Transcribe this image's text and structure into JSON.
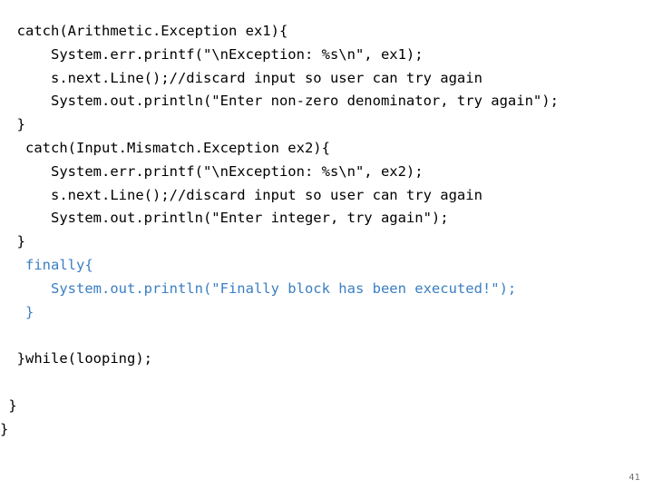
{
  "slide": {
    "page_number": "41",
    "code_lines": [
      {
        "indent": "  ",
        "segments": [
          {
            "text": "catch(Arithmetic.Exception ex1){",
            "color": "black"
          }
        ]
      },
      {
        "indent": "      ",
        "segments": [
          {
            "text": "System.err.printf(\"\\nException: %s\\n\", ex1);",
            "color": "black"
          }
        ]
      },
      {
        "indent": "      ",
        "segments": [
          {
            "text": "s.next.Line();//discard input so user can try again",
            "color": "black"
          }
        ]
      },
      {
        "indent": "      ",
        "segments": [
          {
            "text": "System.out.println(\"Enter non-zero denominator, try again\");",
            "color": "black"
          }
        ]
      },
      {
        "indent": "  ",
        "segments": [
          {
            "text": "}",
            "color": "black"
          }
        ]
      },
      {
        "indent": "   ",
        "segments": [
          {
            "text": "catch(Input.Mismatch.Exception ex2){",
            "color": "black"
          }
        ]
      },
      {
        "indent": "      ",
        "segments": [
          {
            "text": "System.err.printf(\"\\nException: %s\\n\", ex2);",
            "color": "black"
          }
        ]
      },
      {
        "indent": "      ",
        "segments": [
          {
            "text": "s.next.Line();//discard input so user can try again",
            "color": "black"
          }
        ]
      },
      {
        "indent": "      ",
        "segments": [
          {
            "text": "System.out.println(\"Enter integer, try again\");",
            "color": "black"
          }
        ]
      },
      {
        "indent": "  ",
        "segments": [
          {
            "text": "}",
            "color": "black"
          }
        ]
      },
      {
        "indent": "   ",
        "segments": [
          {
            "text": "finally{",
            "color": "blue"
          }
        ]
      },
      {
        "indent": "      ",
        "segments": [
          {
            "text": "System.out.println(\"Finally block has been executed!\");",
            "color": "blue"
          }
        ]
      },
      {
        "indent": "   ",
        "segments": [
          {
            "text": "}",
            "color": "blue"
          }
        ]
      },
      {
        "indent": "",
        "segments": [
          {
            "text": "",
            "color": "black"
          }
        ]
      },
      {
        "indent": "  ",
        "segments": [
          {
            "text": "}while(looping);",
            "color": "black"
          }
        ]
      },
      {
        "indent": "",
        "segments": [
          {
            "text": "",
            "color": "black"
          }
        ]
      },
      {
        "indent": " ",
        "segments": [
          {
            "text": "}",
            "color": "black"
          }
        ]
      },
      {
        "indent": "",
        "segments": [
          {
            "text": "}",
            "color": "black"
          }
        ]
      }
    ]
  },
  "colors": {
    "black": "#000000",
    "blue": "#3b7fc4",
    "page_number": "#6f6f6f"
  }
}
